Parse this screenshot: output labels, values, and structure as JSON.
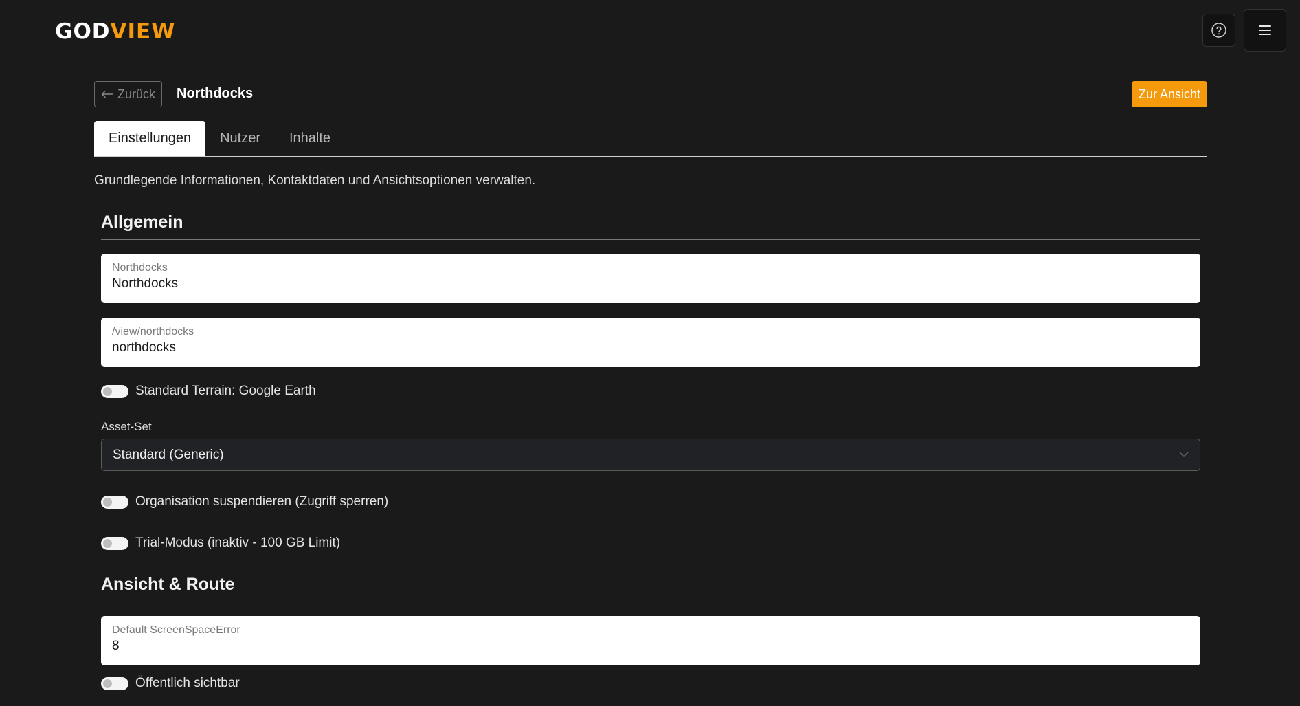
{
  "header": {
    "logo_part1": "GOD",
    "logo_part2": "VIEW",
    "help_icon": "question-circle-icon",
    "menu_icon": "hamburger-menu-icon"
  },
  "page": {
    "back_label": "Zurück",
    "title": "Northdocks",
    "view_button": "Zur Ansicht",
    "description": "Grundlegende Informationen, Kontaktdaten und Ansichtsoptionen verwalten."
  },
  "tabs": [
    {
      "label": "Einstellungen",
      "active": true
    },
    {
      "label": "Nutzer",
      "active": false
    },
    {
      "label": "Inhalte",
      "active": false
    }
  ],
  "general": {
    "heading": "Allgemein",
    "name_label": "Northdocks",
    "name_value": "Northdocks",
    "slug_label": "/view/northdocks",
    "slug_value": "northdocks",
    "terrain_toggle": "Standard Terrain: Google Earth",
    "asset_label": "Asset-Set",
    "asset_value": "Standard (Generic)",
    "suspend_toggle": "Organisation suspendieren (Zugriff sperren)",
    "trial_toggle": "Trial-Modus (inaktiv - 100 GB Limit)"
  },
  "view_route": {
    "heading": "Ansicht & Route",
    "sse_label": "Default ScreenSpaceError",
    "sse_value": "8",
    "public_toggle": "Öffentlich sichtbar"
  },
  "colors": {
    "accent": "#f59a0c",
    "background": "#1a1a1a"
  }
}
